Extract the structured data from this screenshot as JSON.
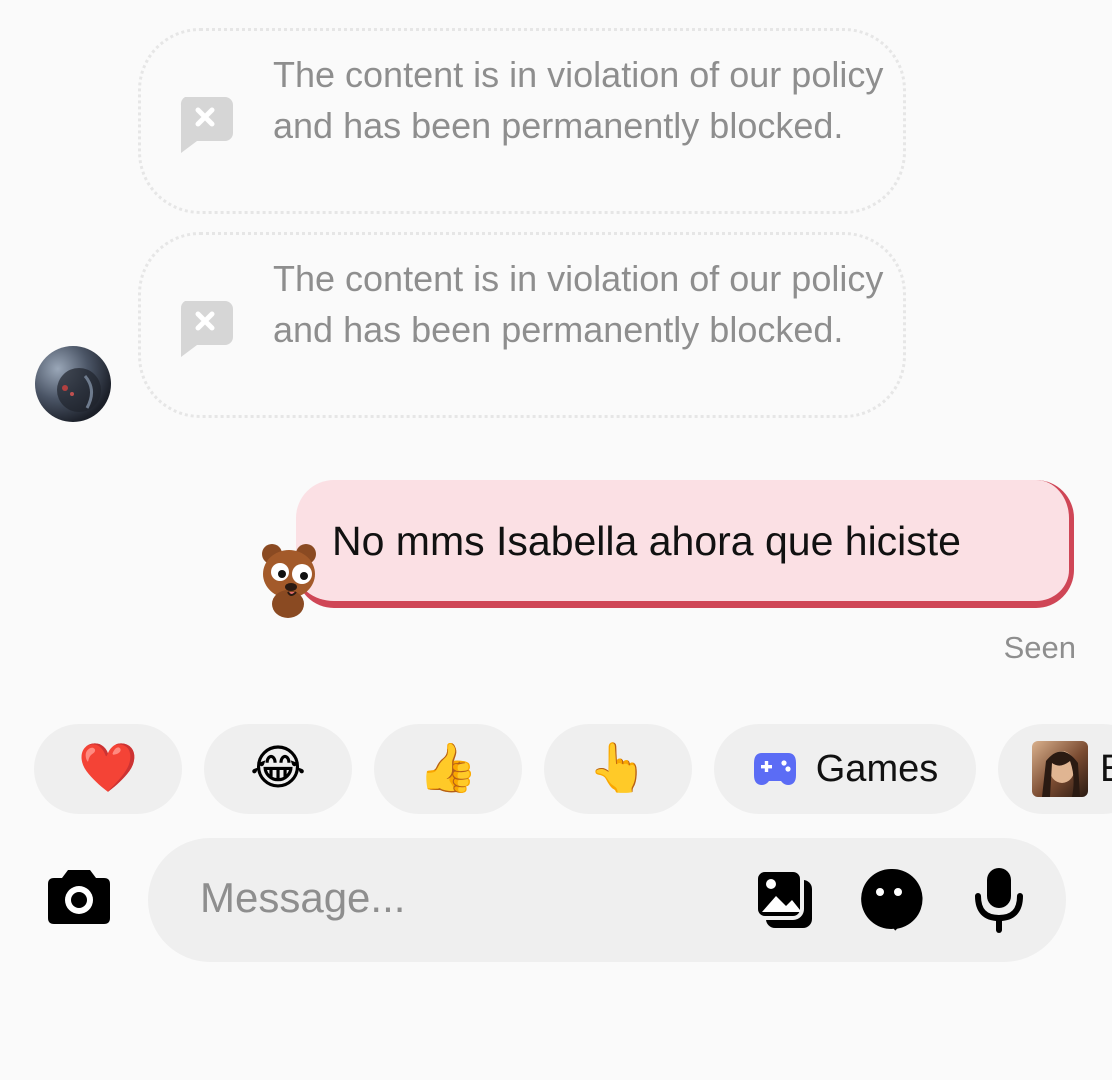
{
  "messages": {
    "blocked_1": {
      "text": "The content is in violation of our policy and has been permanently blocked."
    },
    "blocked_2": {
      "text": "The content is in violation of our policy and has been permanently blocked."
    },
    "sent": {
      "text": "No mms Isabella ahora que hiciste",
      "status": "Seen"
    }
  },
  "quick_replies": [
    {
      "kind": "emoji",
      "glyph": "❤️"
    },
    {
      "kind": "emoji",
      "glyph": "😂"
    },
    {
      "kind": "emoji",
      "glyph": "👍"
    },
    {
      "kind": "emoji",
      "glyph": "👆"
    },
    {
      "kind": "app",
      "label": "Games",
      "icon": "gamepad-icon"
    },
    {
      "kind": "profile",
      "label": "E",
      "icon": "profile-photo"
    }
  ],
  "composer": {
    "placeholder": "Message...",
    "icons": [
      "camera-icon",
      "gallery-icon",
      "sticker-icon",
      "microphone-icon"
    ]
  },
  "colors": {
    "sent_bubble_bg": "#fbe0e4",
    "sent_bubble_accent": "#cf4656",
    "muted_text": "#8e8e8e",
    "games_icon": "#5b6cf5"
  }
}
